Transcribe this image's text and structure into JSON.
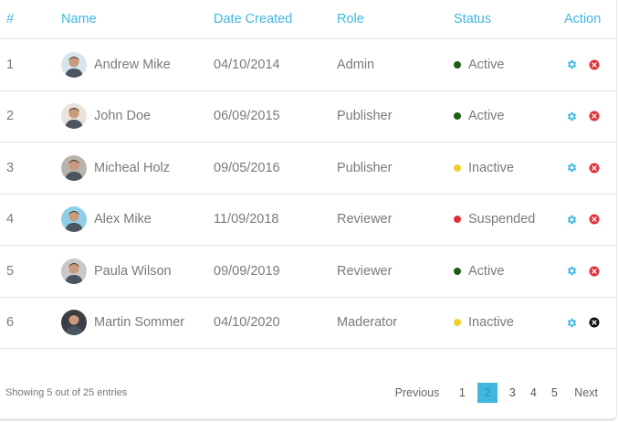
{
  "table": {
    "headers": {
      "num": "#",
      "name": "Name",
      "date": "Date Created",
      "role": "Role",
      "status": "Status",
      "action": "Action"
    },
    "rows": [
      {
        "num": "1",
        "name": "Andrew Mike",
        "date": "04/10/2014",
        "role": "Admin",
        "status": "Active",
        "status_color": "#1e5f14",
        "avatar_bg": "#d9e6ee",
        "delete_color": "#e0323a"
      },
      {
        "num": "2",
        "name": "John Doe",
        "date": "06/09/2015",
        "role": "Publisher",
        "status": "Active",
        "status_color": "#1e5f14",
        "avatar_bg": "#e9e3dc",
        "delete_color": "#e0323a"
      },
      {
        "num": "3",
        "name": "Micheal Holz",
        "date": "09/05/2016",
        "role": "Publisher",
        "status": "Inactive",
        "status_color": "#f0d02c",
        "avatar_bg": "#b9b3ad",
        "delete_color": "#e0323a"
      },
      {
        "num": "4",
        "name": "Alex Mike",
        "date": "11/09/2018",
        "role": "Reviewer",
        "status": "Suspended",
        "status_color": "#e0323a",
        "avatar_bg": "#8fd0e8",
        "delete_color": "#e0323a"
      },
      {
        "num": "5",
        "name": "Paula Wilson",
        "date": "09/09/2019",
        "role": "Reviewer",
        "status": "Active",
        "status_color": "#1e5f14",
        "avatar_bg": "#c8c8c8",
        "delete_color": "#e0323a"
      },
      {
        "num": "6",
        "name": "Martin Sommer",
        "date": "04/10/2020",
        "role": "Maderator",
        "status": "Inactive",
        "status_color": "#f0d02c",
        "avatar_bg": "#3a3f45",
        "delete_color": "#111111"
      }
    ]
  },
  "footer": {
    "entries_text": "Showing 5 out of 25 entries",
    "previous": "Previous",
    "next": "Next",
    "pages": [
      "1",
      "2",
      "3",
      "4",
      "5"
    ],
    "active_page": "2"
  },
  "icons": {
    "settings": "gear-icon",
    "delete": "delete-icon"
  },
  "colors": {
    "accent": "#3fb8e0",
    "active": "#1e5f14",
    "inactive": "#f0d02c",
    "suspended": "#e0323a"
  }
}
